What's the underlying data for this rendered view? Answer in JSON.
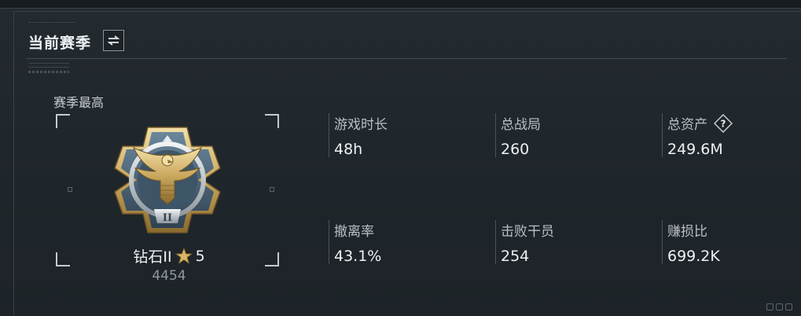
{
  "header": {
    "title": "当前赛季",
    "swap_icon": "swap-arrows-icon"
  },
  "season_best": {
    "label": "赛季最高",
    "rank_name": "钻石II",
    "star_icon": "star-icon",
    "stars": "5",
    "score": "4454",
    "badge_icon": "diamond-eagle-rank-badge"
  },
  "stats": [
    {
      "label": "游戏时长",
      "value": "48h"
    },
    {
      "label": "总战局",
      "value": "260"
    },
    {
      "label": "总资产",
      "value": "249.6M",
      "help_icon": "question-diamond-icon",
      "help_text": "?"
    },
    {
      "label": "撤离率",
      "value": "43.1%"
    },
    {
      "label": "击败干员",
      "value": "254"
    },
    {
      "label": "赚损比",
      "value": "699.2K"
    }
  ],
  "colors": {
    "background": "#1e2429",
    "text_primary": "#eef1f3",
    "text_secondary": "#b9bfc3",
    "gold": "#c9a75e",
    "steel_blue": "#4e6a80"
  }
}
